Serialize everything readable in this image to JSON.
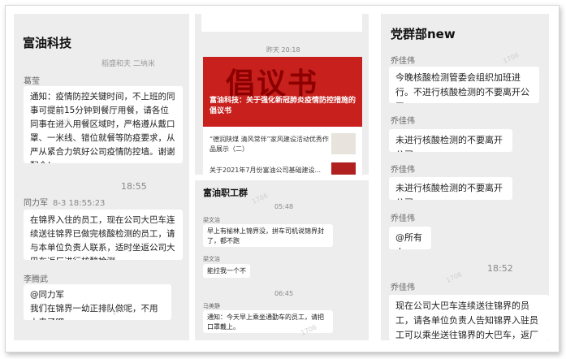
{
  "panel1": {
    "title": "富油科技",
    "top_partial": "稻盛和夫 二纳米",
    "messages": [
      {
        "sender": "葛莹",
        "text": "通知：疫情防控关键时间，不上班的同事可提前15分钟到餐厅用餐，请各位同事在进入用餐区域时，严格遵从戴口罩、一米线、错位就餐等防疫要求，从严从紧合力筑好公司疫情防控墙。谢谢配合！"
      },
      {
        "time": "18:55"
      },
      {
        "sender": "同力军",
        "timestamp": "8-3 18:55:23",
        "text": "在锦界入住的员工，现在公司大巴车连续送往锦界已做完核酸检测的员工，请与本单位负责人联系，适时坐返公司大巴车返厂进行核酸检测。"
      },
      {
        "sender": "李腾武",
        "text": "@同力军\n我们在锦界一幼正排队做呢，不用上来了吧"
      }
    ],
    "watermarks": [
      "1706",
      "1706"
    ]
  },
  "panel2": {
    "timestamp": "昨天 20:18",
    "banner_text": "倡议书",
    "banner_caption": "富油科技：关于强化新冠肺炎疫情防控措施的倡议书",
    "items": [
      {
        "text": "“德润陕煤 清风常伴”家风建设活动优秀作品展示（二）"
      },
      {
        "text": "关于2021年7月份富油公司基础建设..."
      }
    ]
  },
  "panel3": {
    "title": "富油职工群",
    "messages": [
      {
        "time": "05:48"
      },
      {
        "sender": "梁文治",
        "text": "早上有榆林上锦界没，拼车司机说锦界封了，都不跑"
      },
      {
        "sender": "梁文治",
        "text": "能拉我一个不"
      },
      {
        "time": "06:45"
      },
      {
        "sender": "马美静",
        "text": "通知：今天早上乘坐通勤车的员工，请把口罩戴上。"
      }
    ],
    "watermarks": [
      "1706",
      "1706"
    ]
  },
  "panel4": {
    "title": "党群部new",
    "messages": [
      {
        "sender": "乔佳伟",
        "text": "今晚核酸检测管委会组织加班进行。不进行核酸检测的不要离开公司。"
      },
      {
        "sender": "乔佳伟",
        "text": "未进行核酸检测的不要离开公司。"
      },
      {
        "sender": "乔佳伟",
        "text": "未进行核酸检测的不要离开公司。"
      },
      {
        "sender": "乔佳伟",
        "text": "@所有人"
      },
      {
        "time": "18:52"
      },
      {
        "sender": "乔佳伟",
        "text": "现在公司大巴车连续送往锦界的员工，请各单位负责人告知锦界入驻员工可以乘坐送往锦界的大巴车，返厂进行核酸检测。"
      }
    ],
    "watermarks": [
      "1706",
      "1706"
    ]
  }
}
